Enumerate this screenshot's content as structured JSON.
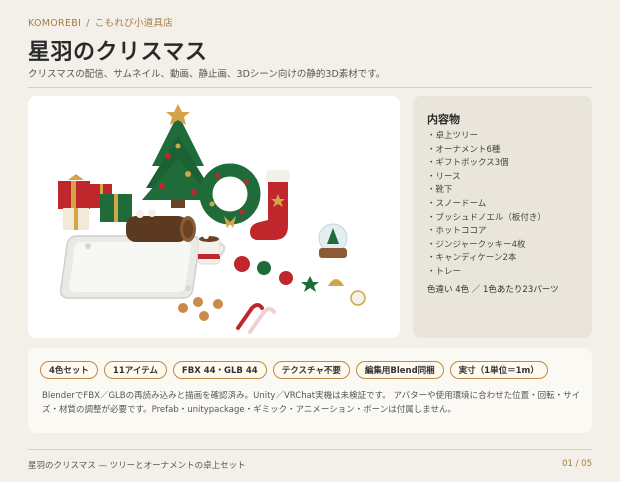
{
  "breadcrumb": {
    "brand": "KOMOREBI",
    "separator": "/",
    "shop": "こもれび小道具店"
  },
  "title": "星羽のクリスマス",
  "subtitle": "クリスマスの配信、サムネイル、動画、静止画、3Dシーン向けの静的3D素材です。",
  "contents": {
    "heading": "内容物",
    "items": [
      "卓上ツリー",
      "オーナメント6種",
      "ギフトボックス3個",
      "リース",
      "靴下",
      "スノードーム",
      "ブッシュドノエル（板付き）",
      "ホットココア",
      "ジンジャークッキー4枚",
      "キャンディケーン2本",
      "トレー"
    ],
    "summary": "色違い 4色 ／ 1色あたり23パーツ"
  },
  "badges": [
    "4色セット",
    "11アイテム",
    "FBX 44・GLB 44",
    "テクスチャ不要",
    "編集用Blend同梱",
    "実寸（1単位＝1m）"
  ],
  "note": "BlenderでFBX／GLBの再読み込みと描画を確認済み。Unity／VRChat実機は未検証です。 アバターや使用環境に合わせた位置・回転・サイズ・材質の調整が必要です。Prefab・unitypackage・ギミック・アニメーション・ボーンは付属しません。",
  "footer": {
    "caption": "星羽のクリスマス — ツリーとオーナメントの卓上セット",
    "page": "01 / 05"
  },
  "colors": {
    "accent": "#a67c3d",
    "background": "#f3f0e9",
    "panel": "#e9e5da",
    "tree": "#1f6b3a",
    "red": "#c0272d",
    "gold": "#d4a546"
  }
}
